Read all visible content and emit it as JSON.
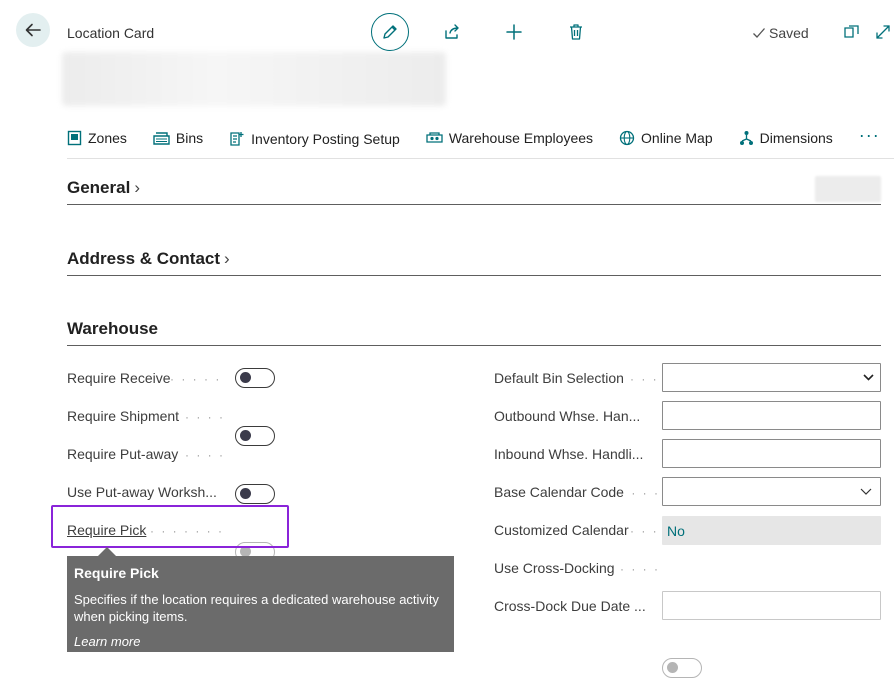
{
  "header": {
    "breadcrumb": "Location Card",
    "saved_status": "Saved"
  },
  "actions": [
    {
      "label": "Zones",
      "icon": "zones-icon"
    },
    {
      "label": "Bins",
      "icon": "bins-icon"
    },
    {
      "label": "Inventory Posting Setup",
      "icon": "inventory-posting-setup-icon"
    },
    {
      "label": "Warehouse Employees",
      "icon": "warehouse-employees-icon"
    },
    {
      "label": "Online Map",
      "icon": "globe-icon"
    },
    {
      "label": "Dimensions",
      "icon": "dimensions-icon"
    }
  ],
  "actions_more": "···",
  "sections": {
    "general": "General",
    "address": "Address & Contact",
    "warehouse": "Warehouse"
  },
  "warehouse_left": [
    {
      "label": "Require Receive",
      "state": "off"
    },
    {
      "label": "Require Shipment",
      "state": "off"
    },
    {
      "label": "Require Put-away",
      "state": "off"
    },
    {
      "label": "Use Put-away Worksh...",
      "state": "disabled-off"
    },
    {
      "label": "Require Pick",
      "state": "on"
    }
  ],
  "warehouse_right": [
    {
      "label": "Default Bin Selection",
      "type": "select",
      "value": ""
    },
    {
      "label": "Outbound Whse. Han...",
      "type": "input",
      "value": ""
    },
    {
      "label": "Inbound Whse. Handli...",
      "type": "input",
      "value": ""
    },
    {
      "label": "Base Calendar Code",
      "type": "select",
      "value": ""
    },
    {
      "label": "Customized Calendar",
      "type": "readonly",
      "value": "No"
    },
    {
      "label": "Use Cross-Docking",
      "type": "toggle",
      "state": "disabled-off"
    },
    {
      "label": "Cross-Dock Due Date ...",
      "type": "input",
      "value": ""
    }
  ],
  "tooltip": {
    "title": "Require Pick",
    "text": "Specifies if the location requires a dedicated warehouse activity when picking items.",
    "learn_more": "Learn more"
  },
  "colors": {
    "accent": "#00707a",
    "focus": "#8a24d9",
    "tooltip_bg": "#6b6b6b"
  }
}
